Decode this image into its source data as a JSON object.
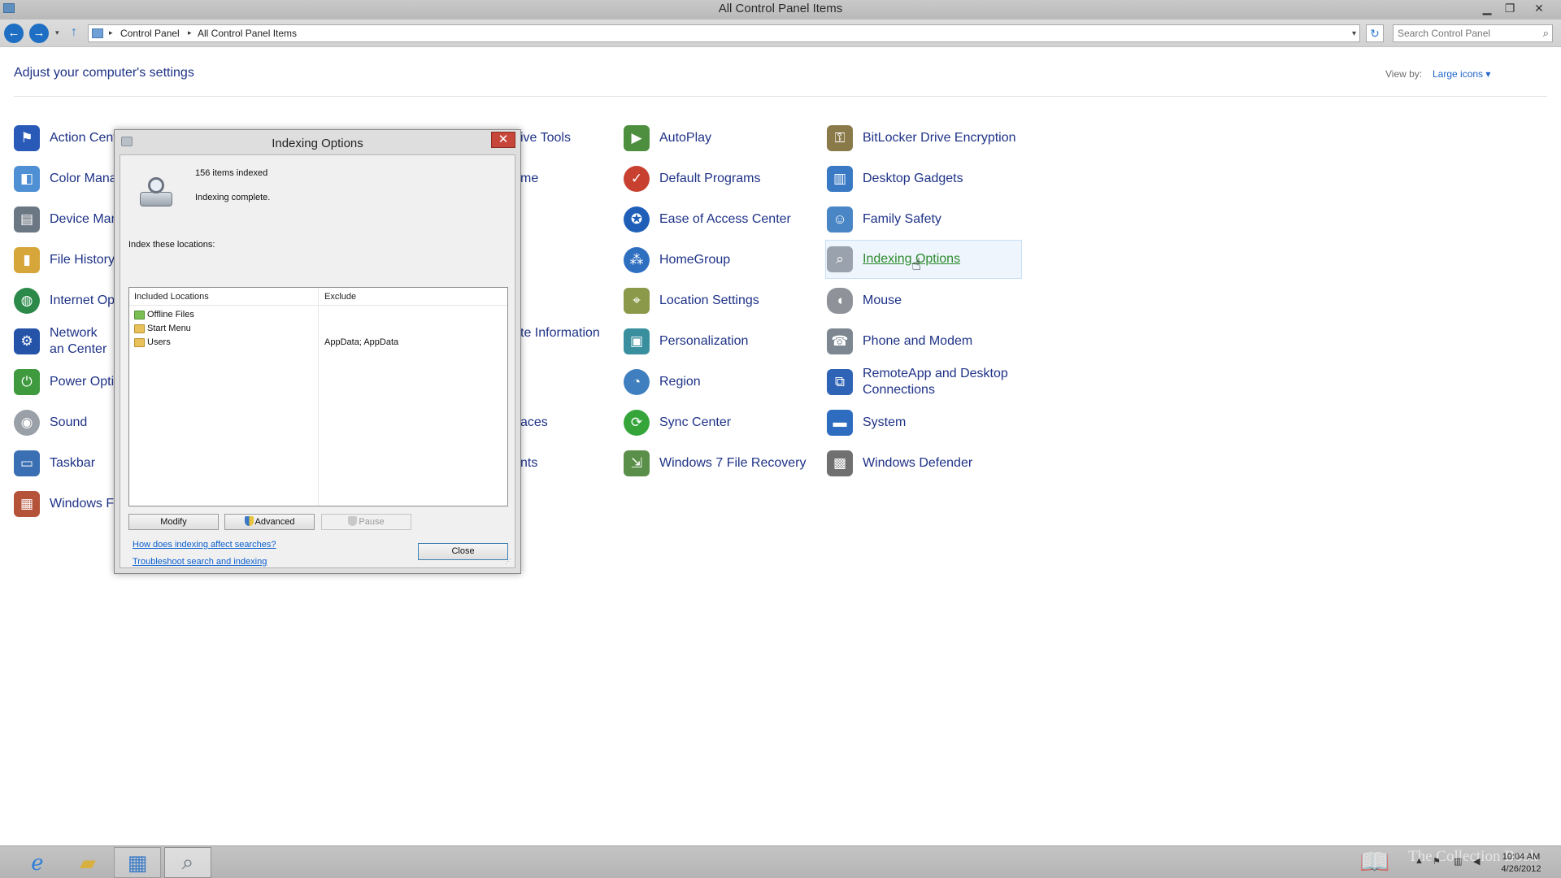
{
  "window": {
    "title": "All Control Panel Items",
    "minimize": "▁",
    "maximize": "❐",
    "close": "✕"
  },
  "address_bar": {
    "back": "←",
    "forward": "→",
    "recent": "▾",
    "up": "↑",
    "breadcrumb": [
      "Control Panel",
      "All Control Panel Items"
    ],
    "separator": "▸",
    "dropdown": "▾",
    "refresh": "↻",
    "search_placeholder": "Search Control Panel",
    "search_icon": "⌕"
  },
  "content": {
    "heading": "Adjust your computer's settings",
    "view_by_label": "View by:",
    "view_by_value": "Large icons ▾"
  },
  "items": {
    "col1": [
      "Action Cent",
      "Color Mana",
      "Device Man",
      "File History",
      "Internet Op",
      "Network an Center",
      "Power Opti",
      "Sound",
      "Taskbar",
      "Windows F"
    ],
    "col3_partial": [
      "ive Tools",
      "me",
      "te Information",
      "aces",
      "nts"
    ],
    "col4": [
      "AutoPlay",
      "Default Programs",
      "Ease of Access Center",
      "HomeGroup",
      "Location Settings",
      "Personalization",
      "Region",
      "Sync Center",
      "Windows 7 File Recovery"
    ],
    "col5": [
      "BitLocker Drive Encryption",
      "Desktop Gadgets",
      "Family Safety",
      "Indexing Options",
      "Mouse",
      "Phone and Modem",
      "RemoteApp and Desktop Connections",
      "System",
      "Windows Defender"
    ]
  },
  "icons": {
    "col1": [
      "flag-icon",
      "color-management-icon",
      "device-manager-icon",
      "file-history-icon",
      "internet-options-icon",
      "network-center-icon",
      "power-options-icon",
      "sound-icon",
      "taskbar-icon",
      "firewall-icon"
    ],
    "col4": [
      "autoplay-icon",
      "default-programs-icon",
      "ease-of-access-icon",
      "homegroup-icon",
      "location-settings-icon",
      "personalization-icon",
      "region-icon",
      "sync-center-icon",
      "file-recovery-icon"
    ],
    "col5": [
      "bitlocker-icon",
      "desktop-gadgets-icon",
      "family-safety-icon",
      "indexing-options-icon",
      "mouse-icon",
      "phone-modem-icon",
      "remoteapp-icon",
      "system-icon",
      "windows-defender-icon"
    ]
  },
  "hovered_item": "Indexing Options",
  "dialog": {
    "title": "Indexing Options",
    "close": "✕",
    "items_indexed": "156 items indexed",
    "status": "Indexing complete.",
    "locations_label": "Index these locations:",
    "columns": [
      "Included Locations",
      "Exclude"
    ],
    "locations": [
      {
        "name": "Offline Files",
        "exclude": ""
      },
      {
        "name": "Start Menu",
        "exclude": ""
      },
      {
        "name": "Users",
        "exclude": "AppData; AppData"
      }
    ],
    "buttons": {
      "modify": "Modify",
      "advanced": "Advanced",
      "pause": "Pause",
      "close": "Close"
    },
    "links": [
      "How does indexing affect searches?",
      "Troubleshoot search and indexing"
    ]
  },
  "taskbar": {
    "apps": [
      "internet-explorer-icon",
      "file-explorer-icon",
      "control-panel-icon",
      "indexing-options-icon"
    ],
    "time": "10:04 AM",
    "date": "4/26/2012",
    "watermark": "The Collection Book"
  },
  "colors": {
    "link_blue": "#1e3287",
    "hover_green": "#2d8a2d",
    "dialog_close_red": "#c7463a",
    "accent_blue": "#1e6fc4"
  }
}
